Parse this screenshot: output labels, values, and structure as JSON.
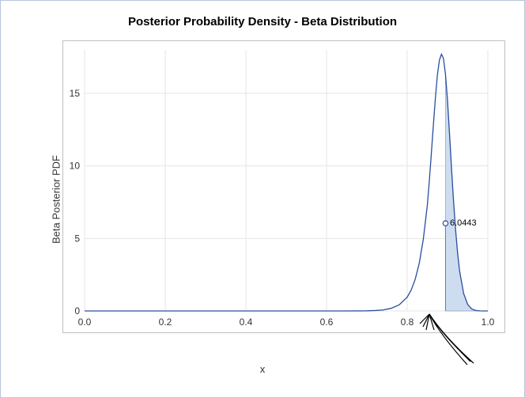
{
  "chart_data": {
    "type": "line",
    "title": "Posterior Probability Density - Beta Distribution",
    "xlabel": "x",
    "ylabel": "Beta Posterior PDF",
    "xlim": [
      0.0,
      1.0
    ],
    "ylim": [
      0,
      18
    ],
    "x_ticks": [
      0.0,
      0.2,
      0.4,
      0.6,
      0.8,
      1.0
    ],
    "y_ticks": [
      0,
      5,
      10,
      15
    ],
    "x": [
      0.0,
      0.05,
      0.1,
      0.15,
      0.2,
      0.25,
      0.3,
      0.35,
      0.4,
      0.45,
      0.5,
      0.55,
      0.6,
      0.65,
      0.7,
      0.72,
      0.74,
      0.76,
      0.78,
      0.8,
      0.81,
      0.82,
      0.83,
      0.84,
      0.85,
      0.855,
      0.86,
      0.865,
      0.87,
      0.875,
      0.88,
      0.885,
      0.89,
      0.895,
      0.9,
      0.905,
      0.91,
      0.915,
      0.92,
      0.925,
      0.93,
      0.94,
      0.95,
      0.96,
      0.97,
      0.98,
      0.99,
      1.0
    ],
    "y": [
      0.0,
      0.0,
      0.0,
      0.0,
      0.0,
      0.0,
      0.0,
      0.0,
      0.0,
      0.0,
      0.0,
      0.0,
      0.0,
      0.0,
      0.01,
      0.03,
      0.07,
      0.18,
      0.42,
      0.95,
      1.45,
      2.2,
      3.3,
      4.95,
      7.3,
      9.0,
      10.9,
      12.85,
      14.7,
      16.3,
      17.3,
      17.7,
      17.4,
      16.3,
      14.5,
      12.2,
      9.8,
      7.55,
      5.6,
      4.0,
      2.75,
      1.2,
      0.45,
      0.14,
      0.035,
      0.006,
      0.0006,
      0.0
    ],
    "shaded_region": {
      "x_start": 0.895,
      "x_end": 1.0
    },
    "annotation": {
      "x": 0.895,
      "y": 6.0443,
      "label": "6.0443"
    }
  },
  "title": "Posterior Probability Density - Beta Distribution",
  "axes": {
    "xlabel": "x",
    "ylabel": "Beta Posterior PDF"
  },
  "ticks": {
    "x": [
      "0.0",
      "0.2",
      "0.4",
      "0.6",
      "0.8",
      "1.0"
    ],
    "y": [
      "0",
      "5",
      "10",
      "15"
    ]
  },
  "annotation_label": "6.0443"
}
